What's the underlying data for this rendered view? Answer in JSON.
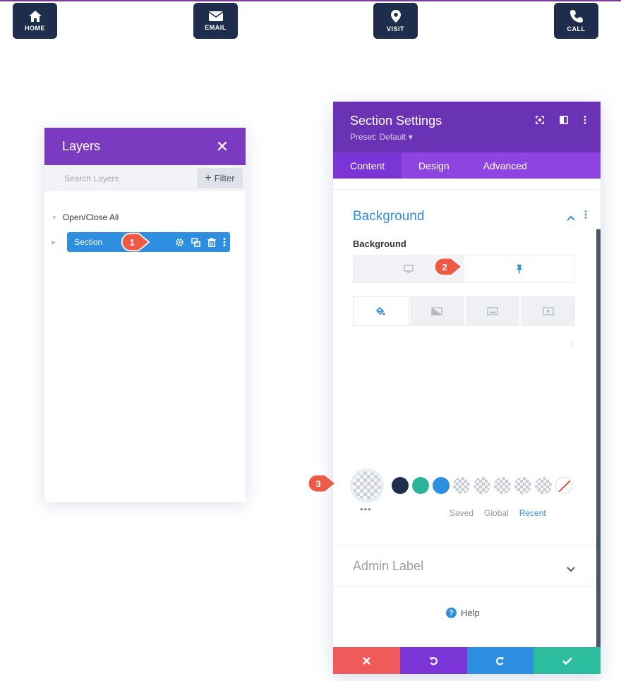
{
  "nav": [
    {
      "label": "HOME",
      "icon": "home-icon"
    },
    {
      "label": "EMAIL",
      "icon": "email-icon"
    },
    {
      "label": "VISIT",
      "icon": "location-pin-icon"
    },
    {
      "label": "CALL",
      "icon": "phone-icon"
    }
  ],
  "layers": {
    "title": "Layers",
    "search_placeholder": "Search Layers",
    "filter_label": "Filter",
    "open_close": "Open/Close All",
    "section_label": "Section"
  },
  "settings": {
    "title": "Section Settings",
    "preset": "Preset: Default ▾",
    "tabs": [
      "Content",
      "Design",
      "Advanced"
    ],
    "active_tab": "Content",
    "background_group": "Background",
    "background_field": "Background",
    "palette": {
      "colors": [
        "#1f2d4d",
        "#2bb39a",
        "#2e8ee0"
      ],
      "links": [
        "Saved",
        "Global",
        "Recent"
      ],
      "active_link": "Recent"
    },
    "admin_label": "Admin Label",
    "help": "Help",
    "footer_colors": [
      "#ef5b5b",
      "#7b35d6",
      "#2e8ee0",
      "#2bbd9e"
    ]
  },
  "callouts": [
    "1",
    "2",
    "3"
  ],
  "colors": {
    "purple_header": "#7b3bc0",
    "accent_blue": "#2e8ee0",
    "nav_dark": "#1f2d4d",
    "callout_red": "#ee5a45"
  }
}
